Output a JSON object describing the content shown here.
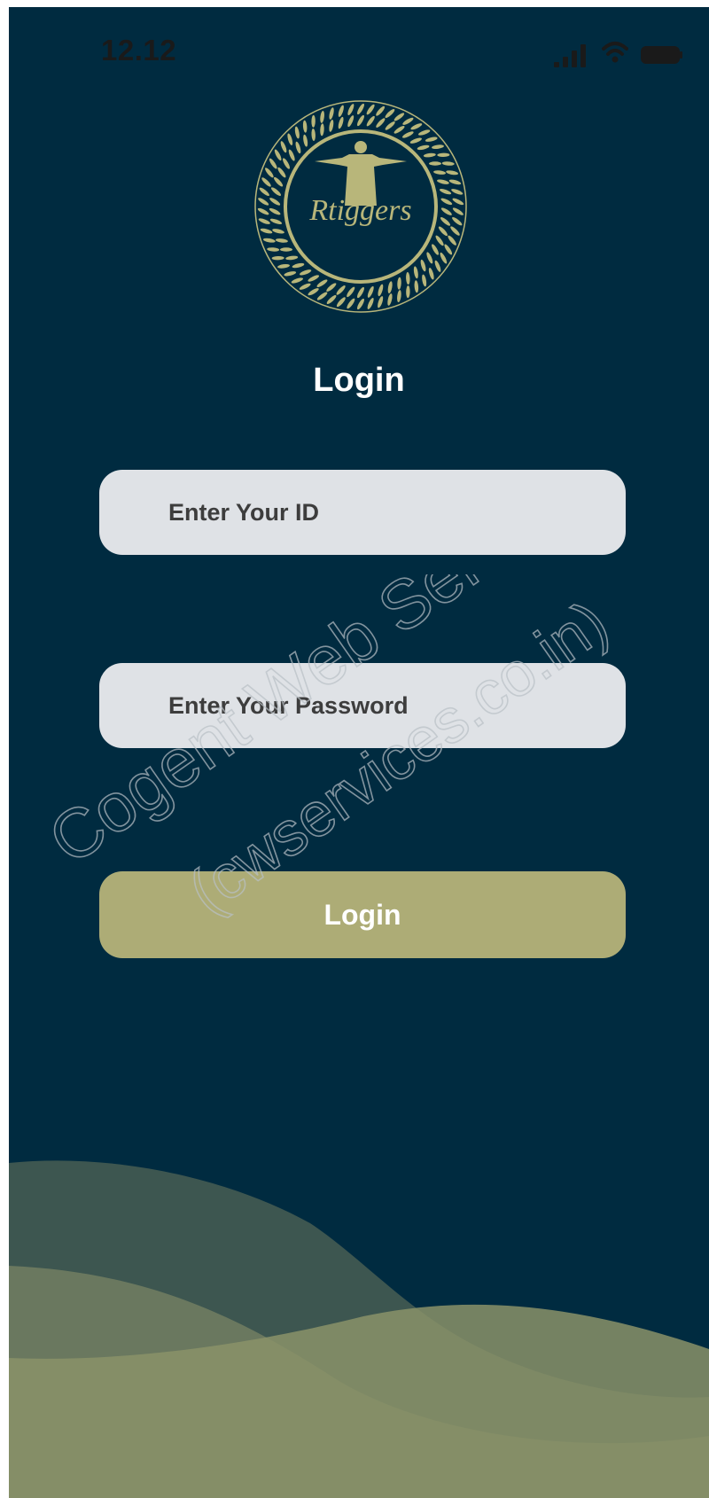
{
  "status_bar": {
    "time": "12.12",
    "icons": [
      "signal-icon",
      "wifi-icon",
      "battery-icon"
    ]
  },
  "logo": {
    "text": "Rtiggers",
    "icon": "statue-logo-icon",
    "color": "#b8b67a"
  },
  "login": {
    "title": "Login",
    "id_placeholder": "Enter Your ID",
    "password_placeholder": "Enter Your Password",
    "button_label": "Login"
  },
  "watermark": {
    "line1": "Cogent Web Services",
    "line2": "(cwservices.co.in)"
  },
  "colors": {
    "background": "#002b40",
    "field_background": "#dfe2e6",
    "button": "#adac76",
    "wave_light": "#8a9268",
    "wave_dark": "#3d5650"
  }
}
